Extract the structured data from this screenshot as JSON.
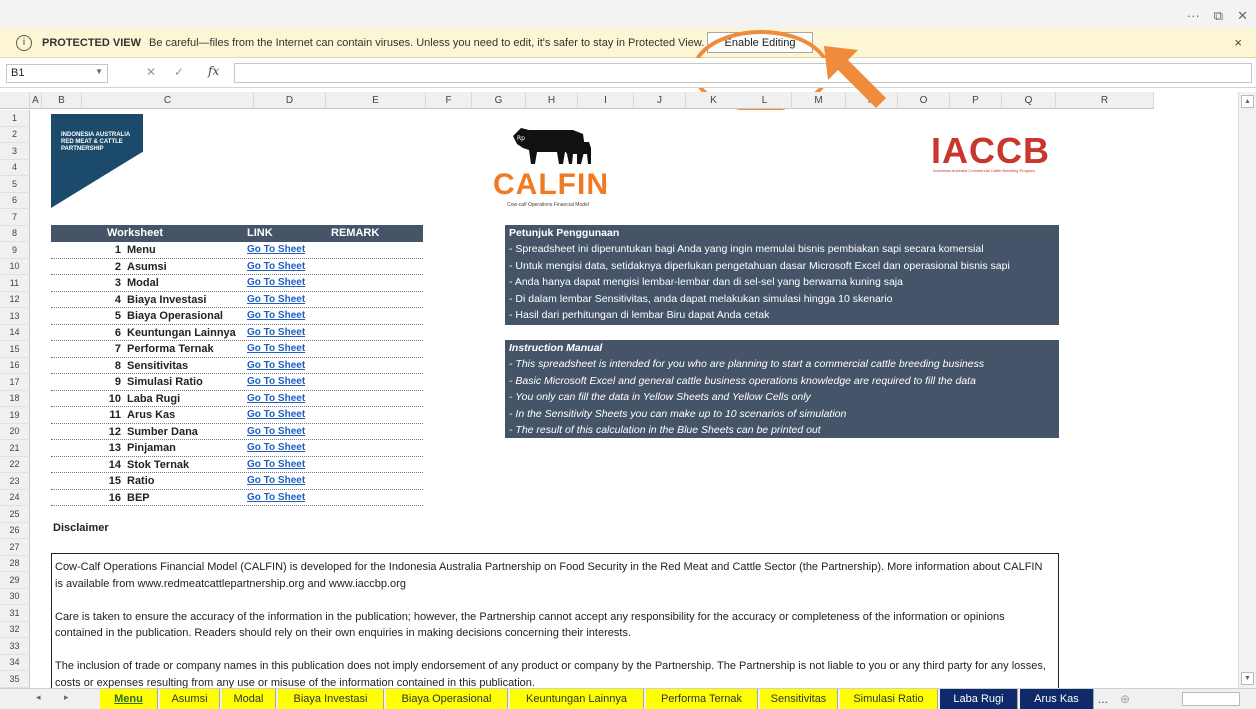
{
  "window": {
    "more_label": "···",
    "restore_label": "⧉",
    "close_label": "✕"
  },
  "protected_view": {
    "title": "PROTECTED VIEW",
    "message": "Be careful—files from the Internet can contain viruses. Unless you need to edit, it's safer to stay in Protected View.",
    "enable_button": "Enable Editing",
    "close_label": "×"
  },
  "formula_bar": {
    "name_box": "B1",
    "cancel": "✕",
    "enter": "✓",
    "fx": "fx",
    "value": ""
  },
  "columns": [
    "A",
    "B",
    "C",
    "D",
    "E",
    "F",
    "G",
    "H",
    "I",
    "J",
    "K",
    "L",
    "M",
    "N",
    "O",
    "P",
    "Q",
    "R"
  ],
  "rows": [
    "1",
    "2",
    "3",
    "4",
    "5",
    "6",
    "7",
    "8",
    "9",
    "10",
    "11",
    "12",
    "13",
    "14",
    "15",
    "16",
    "17",
    "18",
    "19",
    "20",
    "21",
    "22",
    "23",
    "24",
    "25",
    "26",
    "27",
    "28",
    "29",
    "30",
    "31",
    "32",
    "33",
    "34",
    "35"
  ],
  "logos": {
    "left_line1": "INDONESIA AUSTRALIA",
    "left_line2": "RED MEAT & CATTLE",
    "left_line3": "PARTNERSHIP",
    "calfin_mark": "Rp",
    "calfin": "CALFIN",
    "calfin_sub": "Cow-calf Operations Financial Model",
    "iaccb": "IACCB",
    "iaccb_sub": "Indonesia-Australia Commercial Cattle Breeding Program"
  },
  "worksheet_table": {
    "header_worksheet": "Worksheet",
    "header_link": "LINK",
    "header_remark": "REMARK",
    "rows": [
      {
        "num": "1",
        "name": "Menu",
        "link": "Go To Sheet"
      },
      {
        "num": "2",
        "name": "Asumsi",
        "link": "Go To Sheet"
      },
      {
        "num": "3",
        "name": "Modal",
        "link": "Go To Sheet"
      },
      {
        "num": "4",
        "name": "Biaya Investasi",
        "link": "Go To Sheet"
      },
      {
        "num": "5",
        "name": "Biaya Operasional",
        "link": "Go To Sheet"
      },
      {
        "num": "6",
        "name": "Keuntungan Lainnya",
        "link": "Go To Sheet"
      },
      {
        "num": "7",
        "name": "Performa Ternak",
        "link": "Go To Sheet"
      },
      {
        "num": "8",
        "name": "Sensitivitas",
        "link": "Go To Sheet"
      },
      {
        "num": "9",
        "name": "Simulasi Ratio",
        "link": "Go To Sheet"
      },
      {
        "num": "10",
        "name": "Laba Rugi",
        "link": "Go To Sheet"
      },
      {
        "num": "11",
        "name": "Arus Kas",
        "link": "Go To Sheet"
      },
      {
        "num": "12",
        "name": "Sumber Dana",
        "link": "Go To Sheet"
      },
      {
        "num": "13",
        "name": "Pinjaman",
        "link": "Go To Sheet"
      },
      {
        "num": "14",
        "name": "Stok Ternak",
        "link": "Go To Sheet"
      },
      {
        "num": "15",
        "name": "Ratio",
        "link": "Go To Sheet"
      },
      {
        "num": "16",
        "name": "BEP",
        "link": "Go To Sheet"
      }
    ]
  },
  "petunjuk": {
    "title": "Petunjuk Penggunaan",
    "lines": [
      "- Spreadsheet ini diperuntukan bagi Anda yang ingin memulai bisnis pembiakan sapi secara komersial",
      "- Untuk mengisi data, setidaknya diperlukan pengetahuan dasar Microsoft Excel dan operasional bisnis sapi",
      "- Anda hanya dapat mengisi lembar-lembar dan di sel-sel yang berwarna kuning saja",
      "- Di dalam lembar Sensitivitas, anda dapat melakukan simulasi hingga 10 skenario",
      "- Hasil dari perhitungan di lembar Biru dapat Anda cetak"
    ]
  },
  "instruction": {
    "title": "Instruction Manual",
    "lines": [
      "- This spreadsheet is intended for you who are planning to start a commercial cattle breeding business",
      "- Basic Microsoft Excel and general cattle business operations knowledge are required to fill the data",
      "- You only can fill the data in Yellow Sheets and Yellow Cells only",
      "- In the Sensitivity Sheets you can make up to 10 scenarios of simulation",
      "- The result of this calculation in the Blue Sheets can be printed out"
    ]
  },
  "disclaimer": {
    "title": "Disclaimer",
    "p1": "Cow-Calf Operations Financial Model (CALFIN) is developed for the Indonesia Australia Partnership on Food Security in the Red Meat and Cattle Sector (the Partnership). More information about CALFIN is available from www.redmeatcattlepartnership.org and www.iaccbp.org",
    "p2": "Care is taken to ensure the accuracy of the information in the publication; however, the Partnership cannot accept any responsibility for the accuracy or completeness of the information or opinions contained in the publication. Readers should rely on their own enquiries in making decisions concerning their interests.",
    "p3": "The inclusion of trade or company names in this publication does not imply endorsement of any product or company by the Partnership. The Partnership is not liable to you or any third party for any losses, costs or expenses resulting from any use or misuse of the information contained in this publication."
  },
  "tabs": [
    {
      "label": "Menu",
      "kind": "active"
    },
    {
      "label": "Asumsi",
      "kind": "yellow"
    },
    {
      "label": "Modal",
      "kind": "yellow"
    },
    {
      "label": "Biaya Investasi",
      "kind": "yellow"
    },
    {
      "label": "Biaya Operasional",
      "kind": "yellow"
    },
    {
      "label": "Keuntungan Lainnya",
      "kind": "yellow"
    },
    {
      "label": "Performa Ternak",
      "kind": "yellow"
    },
    {
      "label": "Sensitivitas",
      "kind": "yellow"
    },
    {
      "label": "Simulasi Ratio",
      "kind": "yellow"
    },
    {
      "label": "Laba Rugi",
      "kind": "blue"
    },
    {
      "label": "Arus Kas",
      "kind": "blue"
    }
  ],
  "tab_more": "...",
  "tab_add": "⊕",
  "colors": {
    "accent_orange": "#ef8c3c",
    "header_slate": "#46546a",
    "tab_yellow": "#ffff00",
    "tab_blue": "#0e2a6a"
  }
}
